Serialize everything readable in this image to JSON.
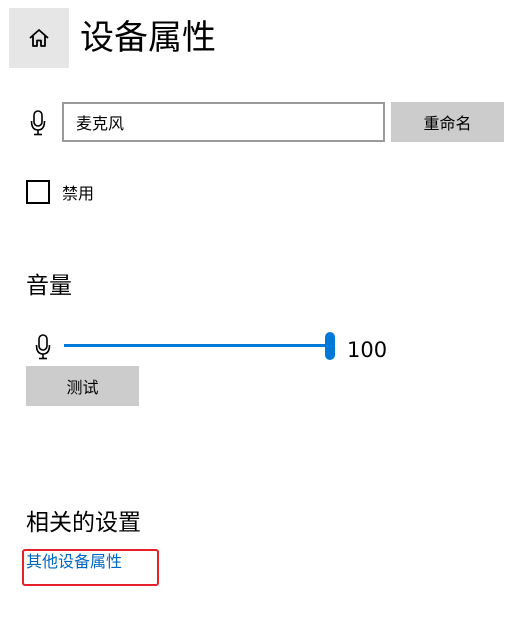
{
  "header": {
    "title": "设备属性",
    "home_icon": "home-icon"
  },
  "device": {
    "icon": "microphone-icon",
    "name_value": "麦克风",
    "rename_label": "重命名",
    "disable_label": "禁用",
    "disabled": false
  },
  "volume": {
    "heading": "音量",
    "icon": "microphone-icon",
    "value": 100,
    "value_text": "100",
    "min": 0,
    "max": 100,
    "test_label": "测试"
  },
  "related": {
    "heading": "相关的设置",
    "link_label": "其他设备属性"
  },
  "colors": {
    "accent": "#0078d7",
    "link": "#0067c0",
    "button_bg": "#cccccc",
    "highlight": "#e8202a"
  }
}
